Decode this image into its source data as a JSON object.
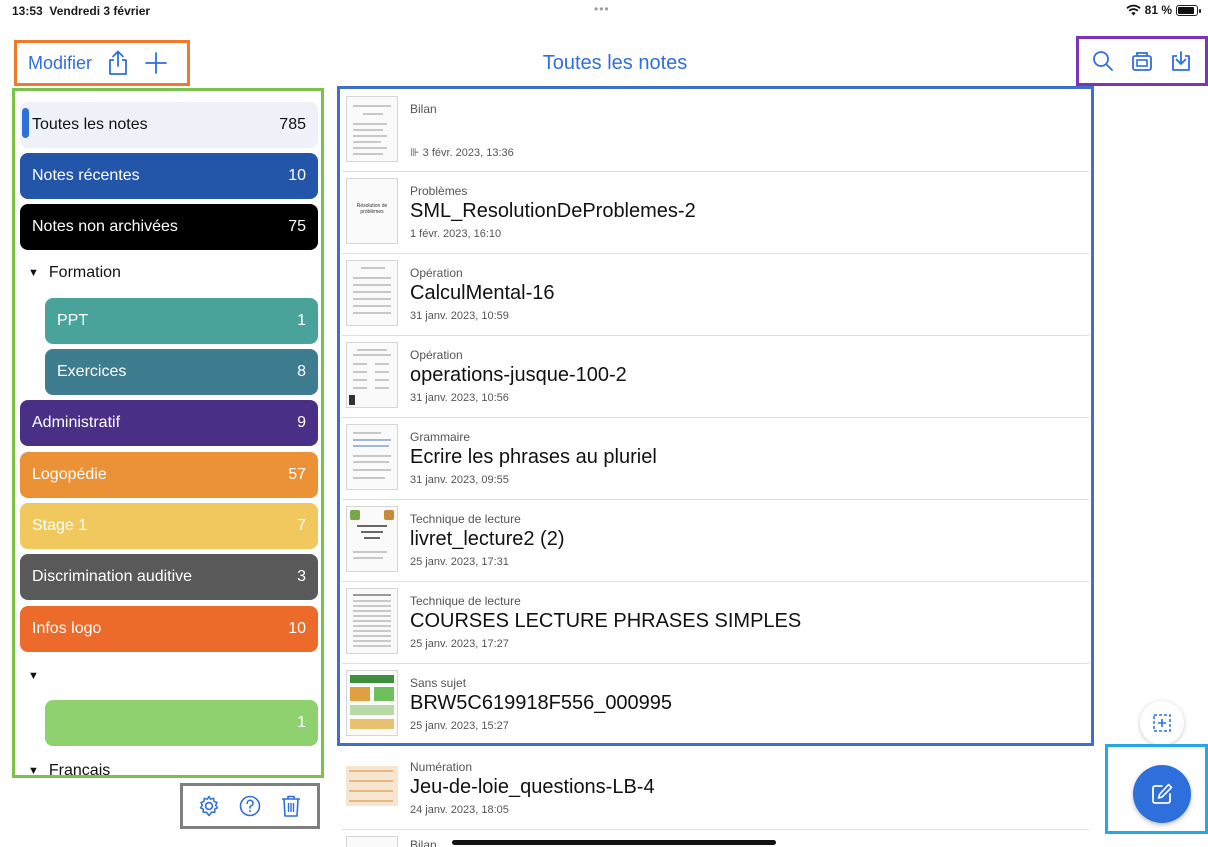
{
  "status": {
    "time": "13:53",
    "date": "Vendredi 3 février",
    "dots": "•••",
    "battery": "81 %",
    "battery_level": 0.81
  },
  "toolbar": {
    "edit_label": "Modifier",
    "title": "Toutes les notes"
  },
  "sidebar": {
    "items": [
      {
        "label": "Toutes les notes",
        "count": "785",
        "color": "#eef1f8"
      },
      {
        "label": "Notes récentes",
        "count": "10",
        "color": "#2355a8"
      },
      {
        "label": "Notes non archivées",
        "count": "75",
        "color": "#000000"
      }
    ],
    "group_formation": {
      "label": "Formation"
    },
    "formation_items": [
      {
        "label": "PPT",
        "count": "1",
        "color": "#4aa39a"
      },
      {
        "label": "Exercices",
        "count": "8",
        "color": "#3e7c90"
      }
    ],
    "more_items": [
      {
        "label": "Administratif",
        "count": "9",
        "color": "#4a2f86"
      },
      {
        "label": "Logopédie",
        "count": "57",
        "color": "#ec9236"
      },
      {
        "label": "Stage 1",
        "count": "7",
        "color": "#f0c85e"
      },
      {
        "label": "Discrimination auditive",
        "count": "3",
        "color": "#595959"
      },
      {
        "label": "Infos logo",
        "count": "10",
        "color": "#ec6a2a"
      }
    ],
    "unnamed_group": {
      "label": ""
    },
    "unnamed_item": {
      "label": "",
      "count": "1",
      "color": "#8fd16f"
    },
    "group_francais": {
      "label": "Francais"
    }
  },
  "notes": [
    {
      "subject": "Bilan",
      "title": "",
      "date": "3 févr. 2023, 13:36",
      "audio_mark": "⊪"
    },
    {
      "subject": "Problèmes",
      "title": "SML_ResolutionDeProblemes-2",
      "date": "1 févr. 2023, 16:10",
      "thumb_text": "Résolution de problèmes"
    },
    {
      "subject": "Opération",
      "title": "CalculMental-16",
      "date": "31 janv. 2023, 10:59"
    },
    {
      "subject": "Opération",
      "title": "operations-jusque-100-2",
      "date": "31 janv. 2023, 10:56"
    },
    {
      "subject": "Grammaire",
      "title": "Ecrire les phrases au pluriel",
      "date": "31 janv. 2023, 09:55"
    },
    {
      "subject": "Technique de lecture",
      "title": "livret_lecture2 (2)",
      "date": "25 janv. 2023, 17:31"
    },
    {
      "subject": "Technique de lecture",
      "title": "COURSES LECTURE PHRASES SIMPLES",
      "date": "25 janv. 2023, 17:27"
    },
    {
      "subject": "Sans sujet",
      "title": "BRW5C619918F556_000995",
      "date": "25 janv. 2023, 15:27"
    },
    {
      "subject": "Numération",
      "title": "Jeu-de-loie_questions-LB-4",
      "date": "24 janv. 2023, 18:05"
    },
    {
      "subject": "Bilan",
      "title": "",
      "date": ""
    }
  ],
  "colors": {
    "accent": "#2f6fdc"
  },
  "icons": [
    "wifi-icon",
    "battery-icon",
    "share-icon",
    "plus-icon",
    "search-icon",
    "scan-icon",
    "import-icon",
    "settings-icon",
    "help-icon",
    "trash-icon",
    "compose-icon",
    "add-box-icon"
  ]
}
